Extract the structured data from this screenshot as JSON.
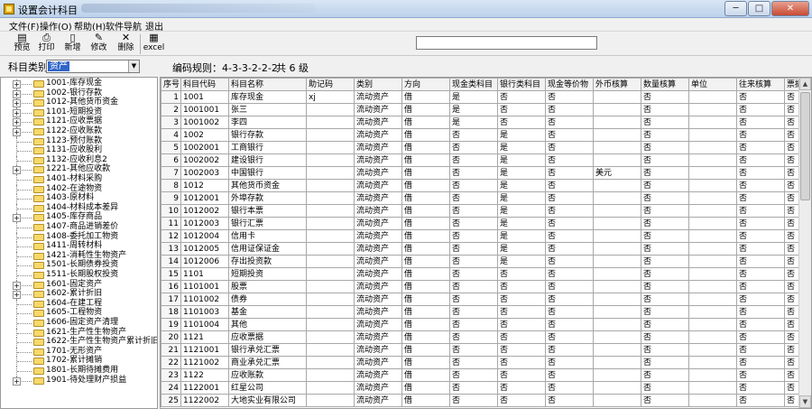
{
  "window": {
    "title": "设置会计科目",
    "minimize": "─",
    "maximize": "□",
    "close": "✕"
  },
  "menu": [
    "文件(F)",
    "操作(O)",
    "帮助(H)",
    "软件导航",
    "退出"
  ],
  "toolbar": [
    {
      "label": "预览",
      "icon": "preview-icon",
      "glyph": "▤"
    },
    {
      "label": "打印",
      "icon": "print-icon",
      "glyph": "⎙"
    },
    {
      "label": "新增",
      "icon": "new-icon",
      "glyph": "▯"
    },
    {
      "label": "修改",
      "icon": "edit-icon",
      "glyph": "✎"
    },
    {
      "label": "删除",
      "icon": "delete-icon",
      "glyph": "✕"
    },
    {
      "label": "excel",
      "icon": "excel-icon",
      "glyph": "▦"
    }
  ],
  "search": {
    "value": ""
  },
  "filter": {
    "category_label": "科目类别",
    "category_value": "资产",
    "code_rule": "编码规则：4-3-3-2-2-2",
    "level_count": "共 6 级"
  },
  "tree": [
    {
      "label": "1001-库存现金",
      "expander": "+"
    },
    {
      "label": "1002-银行存款",
      "expander": "+"
    },
    {
      "label": "1012-其他货币资金",
      "expander": "+"
    },
    {
      "label": "1101-短期投资",
      "expander": "+"
    },
    {
      "label": "1121-应收票据",
      "expander": "+"
    },
    {
      "label": "1122-应收账款",
      "expander": "+"
    },
    {
      "label": "1123-预付账款",
      "expander": ""
    },
    {
      "label": "1131-应收股利",
      "expander": ""
    },
    {
      "label": "1132-应收利息2",
      "expander": ""
    },
    {
      "label": "1221-其他应收款",
      "expander": "+"
    },
    {
      "label": "1401-材料采购",
      "expander": ""
    },
    {
      "label": "1402-在途物资",
      "expander": ""
    },
    {
      "label": "1403-原材料",
      "expander": ""
    },
    {
      "label": "1404-材料成本差异",
      "expander": ""
    },
    {
      "label": "1405-库存商品",
      "expander": "+"
    },
    {
      "label": "1407-商品进销差价",
      "expander": ""
    },
    {
      "label": "1408-委托加工物资",
      "expander": ""
    },
    {
      "label": "1411-周转材料",
      "expander": ""
    },
    {
      "label": "1421-消耗性生物资产",
      "expander": ""
    },
    {
      "label": "1501-长期债券投资",
      "expander": ""
    },
    {
      "label": "1511-长期股权投资",
      "expander": ""
    },
    {
      "label": "1601-固定资产",
      "expander": "+"
    },
    {
      "label": "1602-累计折旧",
      "expander": "+"
    },
    {
      "label": "1604-在建工程",
      "expander": ""
    },
    {
      "label": "1605-工程物资",
      "expander": ""
    },
    {
      "label": "1606-固定资产清理",
      "expander": ""
    },
    {
      "label": "1621-生产性生物资产",
      "expander": ""
    },
    {
      "label": "1622-生产性生物资产累计折旧",
      "expander": ""
    },
    {
      "label": "1701-无形资产",
      "expander": ""
    },
    {
      "label": "1702-累计摊销",
      "expander": ""
    },
    {
      "label": "1801-长期待摊费用",
      "expander": ""
    },
    {
      "label": "1901-待处理财产损益",
      "expander": "+"
    }
  ],
  "grid": {
    "headers": [
      "序号",
      "科目代码",
      "科目名称",
      "助记码",
      "类别",
      "方向",
      "现金类科目",
      "银行类科目",
      "现金等价物",
      "外币核算",
      "数量核算",
      "单位",
      "往来核算",
      "票据"
    ],
    "rows": [
      [
        "1",
        "1001",
        "库存现金",
        "xj",
        "流动资产",
        "借",
        "是",
        "否",
        "否",
        "",
        "否",
        "",
        "否",
        "否"
      ],
      [
        "2",
        "1001001",
        "张三",
        "",
        "流动资产",
        "借",
        "是",
        "否",
        "否",
        "",
        "否",
        "",
        "否",
        "否"
      ],
      [
        "3",
        "1001002",
        "李四",
        "",
        "流动资产",
        "借",
        "是",
        "否",
        "否",
        "",
        "否",
        "",
        "否",
        "否"
      ],
      [
        "4",
        "1002",
        "银行存款",
        "",
        "流动资产",
        "借",
        "否",
        "是",
        "否",
        "",
        "否",
        "",
        "否",
        "否"
      ],
      [
        "5",
        "1002001",
        "工商银行",
        "",
        "流动资产",
        "借",
        "否",
        "是",
        "否",
        "",
        "否",
        "",
        "否",
        "否"
      ],
      [
        "6",
        "1002002",
        "建设银行",
        "",
        "流动资产",
        "借",
        "否",
        "是",
        "否",
        "",
        "否",
        "",
        "否",
        "否"
      ],
      [
        "7",
        "1002003",
        "中国银行",
        "",
        "流动资产",
        "借",
        "否",
        "是",
        "否",
        "美元",
        "否",
        "",
        "否",
        "否"
      ],
      [
        "8",
        "1012",
        "其他货币资金",
        "",
        "流动资产",
        "借",
        "否",
        "是",
        "否",
        "",
        "否",
        "",
        "否",
        "否"
      ],
      [
        "9",
        "1012001",
        "外埠存款",
        "",
        "流动资产",
        "借",
        "否",
        "是",
        "否",
        "",
        "否",
        "",
        "否",
        "否"
      ],
      [
        "10",
        "1012002",
        "银行本票",
        "",
        "流动资产",
        "借",
        "否",
        "是",
        "否",
        "",
        "否",
        "",
        "否",
        "否"
      ],
      [
        "11",
        "1012003",
        "银行汇票",
        "",
        "流动资产",
        "借",
        "否",
        "是",
        "否",
        "",
        "否",
        "",
        "否",
        "否"
      ],
      [
        "12",
        "1012004",
        "信用卡",
        "",
        "流动资产",
        "借",
        "否",
        "是",
        "否",
        "",
        "否",
        "",
        "否",
        "否"
      ],
      [
        "13",
        "1012005",
        "信用证保证金",
        "",
        "流动资产",
        "借",
        "否",
        "是",
        "否",
        "",
        "否",
        "",
        "否",
        "否"
      ],
      [
        "14",
        "1012006",
        "存出投资款",
        "",
        "流动资产",
        "借",
        "否",
        "是",
        "否",
        "",
        "否",
        "",
        "否",
        "否"
      ],
      [
        "15",
        "1101",
        "短期投资",
        "",
        "流动资产",
        "借",
        "否",
        "否",
        "否",
        "",
        "否",
        "",
        "否",
        "否"
      ],
      [
        "16",
        "1101001",
        "股票",
        "",
        "流动资产",
        "借",
        "否",
        "否",
        "否",
        "",
        "否",
        "",
        "否",
        "否"
      ],
      [
        "17",
        "1101002",
        "债券",
        "",
        "流动资产",
        "借",
        "否",
        "否",
        "否",
        "",
        "否",
        "",
        "否",
        "否"
      ],
      [
        "18",
        "1101003",
        "基金",
        "",
        "流动资产",
        "借",
        "否",
        "否",
        "否",
        "",
        "否",
        "",
        "否",
        "否"
      ],
      [
        "19",
        "1101004",
        "其他",
        "",
        "流动资产",
        "借",
        "否",
        "否",
        "否",
        "",
        "否",
        "",
        "否",
        "否"
      ],
      [
        "20",
        "1121",
        "应收票据",
        "",
        "流动资产",
        "借",
        "否",
        "否",
        "否",
        "",
        "否",
        "",
        "否",
        "否"
      ],
      [
        "21",
        "1121001",
        "银行承兑汇票",
        "",
        "流动资产",
        "借",
        "否",
        "否",
        "否",
        "",
        "否",
        "",
        "否",
        "否"
      ],
      [
        "22",
        "1121002",
        "商业承兑汇票",
        "",
        "流动资产",
        "借",
        "否",
        "否",
        "否",
        "",
        "否",
        "",
        "否",
        "否"
      ],
      [
        "23",
        "1122",
        "应收账款",
        "",
        "流动资产",
        "借",
        "否",
        "否",
        "否",
        "",
        "否",
        "",
        "否",
        "否"
      ],
      [
        "24",
        "1122001",
        "红星公司",
        "",
        "流动资产",
        "借",
        "否",
        "否",
        "否",
        "",
        "否",
        "",
        "否",
        "否"
      ],
      [
        "25",
        "1122002",
        "大地实业有限公司",
        "",
        "流动资产",
        "借",
        "否",
        "否",
        "否",
        "",
        "否",
        "",
        "否",
        "否"
      ]
    ]
  }
}
